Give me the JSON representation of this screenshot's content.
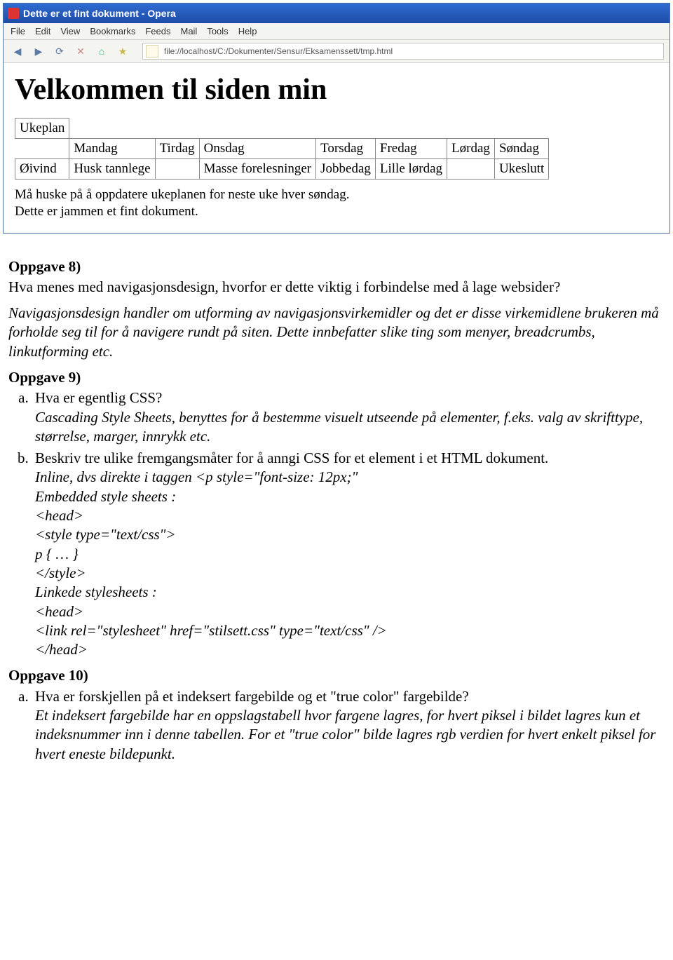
{
  "browser": {
    "title": "Dette er et fint dokument - Opera",
    "menu": [
      "File",
      "Edit",
      "View",
      "Bookmarks",
      "Feeds",
      "Mail",
      "Tools",
      "Help"
    ],
    "address": "file://localhost/C:/Dokumenter/Sensur/Eksamenssett/tmp.html"
  },
  "page": {
    "heading": "Velkommen til siden min",
    "table": {
      "corner": "Ukeplan",
      "days": [
        "Mandag",
        "Tirdag",
        "Onsdag",
        "Torsdag",
        "Fredag",
        "Lørdag",
        "Søndag"
      ],
      "row_label": "Øivind",
      "cells": [
        "Husk tannlege",
        "",
        "Masse forelesninger",
        "Jobbedag",
        "Lille lørdag",
        "",
        "Ukeslutt"
      ]
    },
    "notes": [
      "Må huske på å oppdatere ukeplanen for neste uke hver søndag.",
      "Dette er jammen et fint dokument."
    ]
  },
  "doc": {
    "oppg8": {
      "title": "Oppgave 8)",
      "question": "Hva menes med navigasjonsdesign, hvorfor er dette viktig i forbindelse med å lage websider?",
      "answer": "Navigasjonsdesign handler om utforming av navigasjonsvirkemidler og det er disse virkemidlene brukeren må forholde seg til for å navigere rundt på siten. Dette innbefatter slike ting som menyer, breadcrumbs, linkutforming etc."
    },
    "oppg9": {
      "title": "Oppgave 9)",
      "a_q": "Hva er egentlig CSS?",
      "a_a": "Cascading Style Sheets, benyttes for å bestemme visuelt utseende på elementer, f.eks. valg av skrifttype, størrelse, marger, innrykk etc.",
      "b_q": "Beskriv tre ulike fremgangsmåter for å anngi CSS for et element i et HTML dokument.",
      "b_lines": [
        "Inline, dvs direkte i taggen <p style=\"font-size: 12px;\"",
        "Embedded style sheets :",
        "<head>",
        "<style type=\"text/css\">",
        " p { … }",
        "</style>",
        "Linkede stylesheets :",
        "<head>",
        "<link rel=\"stylesheet\" href=\"stilsett.css\" type=\"text/css\" />",
        "</head>"
      ]
    },
    "oppg10": {
      "title": "Oppgave 10)",
      "a_q": "Hva er forskjellen på et indeksert fargebilde og et \"true color\" fargebilde?",
      "a_a": "Et indeksert fargebilde har en oppslagstabell hvor fargene lagres, for hvert piksel i bildet lagres kun et indeksnummer inn i denne tabellen. For et \"true color\" bilde lagres rgb verdien for hvert enkelt piksel for hvert eneste bildepunkt."
    }
  }
}
